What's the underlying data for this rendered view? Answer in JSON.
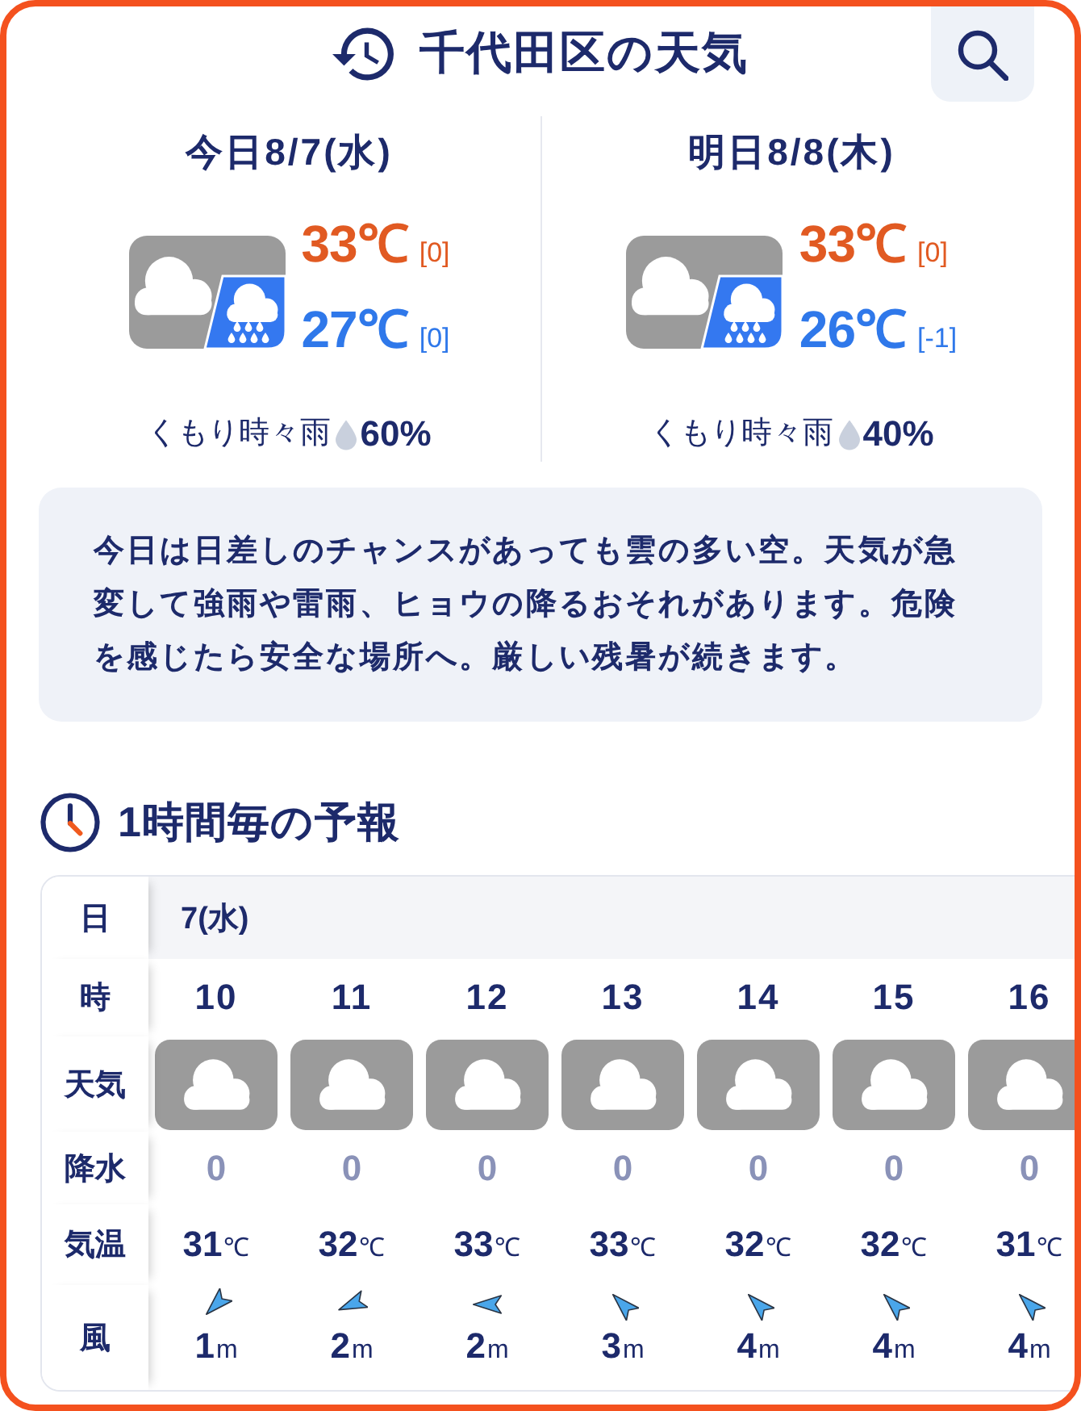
{
  "header": {
    "title": "千代田区の天気"
  },
  "days": [
    {
      "date": "今日8/7(水)",
      "kind": "cloudy_rain",
      "high": "33℃",
      "high_diff": "[0]",
      "low": "27℃",
      "low_diff": "[0]",
      "condition": "くもり時々雨",
      "precip": "60%"
    },
    {
      "date": "明日8/8(木)",
      "kind": "cloudy_rain",
      "high": "33℃",
      "high_diff": "[0]",
      "low": "26℃",
      "low_diff": "[-1]",
      "condition": "くもり時々雨",
      "precip": "40%"
    }
  ],
  "summary": "今日は日差しのチャンスがあっても雲の多い空。天気が急変して強雨や雷雨、ヒョウの降るおそれがあります。危険を感じたら安全な場所へ。厳しい残暑が続きます。",
  "hourly": {
    "title": "1時間毎の予報",
    "row_labels": [
      "日",
      "時",
      "天気",
      "降水",
      "気温",
      "風"
    ],
    "date": "7(水)",
    "hours": [
      {
        "hour": "10",
        "kind": "cloudy",
        "precip": "0",
        "temp": "31",
        "temp_unit": "℃",
        "wind": {
          "kind": "SW",
          "speed": "1",
          "unit": "m"
        }
      },
      {
        "hour": "11",
        "kind": "cloudy",
        "precip": "0",
        "temp": "32",
        "temp_unit": "℃",
        "wind": {
          "kind": "WSW",
          "speed": "2",
          "unit": "m"
        }
      },
      {
        "hour": "12",
        "kind": "cloudy",
        "precip": "0",
        "temp": "33",
        "temp_unit": "℃",
        "wind": {
          "kind": "W",
          "speed": "2",
          "unit": "m"
        }
      },
      {
        "hour": "13",
        "kind": "cloudy",
        "precip": "0",
        "temp": "33",
        "temp_unit": "℃",
        "wind": {
          "kind": "NW",
          "speed": "3",
          "unit": "m"
        }
      },
      {
        "hour": "14",
        "kind": "cloudy",
        "precip": "0",
        "temp": "32",
        "temp_unit": "℃",
        "wind": {
          "kind": "NW",
          "speed": "4",
          "unit": "m"
        }
      },
      {
        "hour": "15",
        "kind": "cloudy",
        "precip": "0",
        "temp": "32",
        "temp_unit": "℃",
        "wind": {
          "kind": "NW",
          "speed": "4",
          "unit": "m"
        }
      },
      {
        "hour": "16",
        "kind": "cloudy",
        "precip": "0",
        "temp": "31",
        "temp_unit": "℃",
        "wind": {
          "kind": "NW",
          "speed": "4",
          "unit": "m"
        }
      }
    ]
  }
}
